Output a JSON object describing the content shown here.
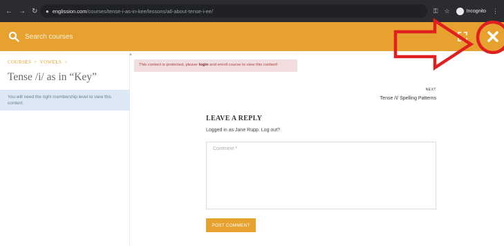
{
  "browser": {
    "url_domain": "englission.com",
    "url_path": "/courses/tense-i-as-in-kee/lessons/all-about-tense-i-ee/",
    "profile_label": "Incognito",
    "icons": [
      "back-arrow",
      "forward-arrow",
      "reload",
      "lock",
      "key",
      "star",
      "incognito-avatar",
      "kebab-menu"
    ]
  },
  "header": {
    "search_placeholder": "Search courses",
    "bg_color": "#e6a12e",
    "icons": [
      "search-icon",
      "expand-icon",
      "close-icon"
    ]
  },
  "sidebar": {
    "breadcrumb": [
      "COURSES",
      "VOWELS"
    ],
    "breadcrumb_sep": ">",
    "lesson_title": "Tense /i/ as in “Key”",
    "membership_note": "You will need the right membership level to view this content."
  },
  "main": {
    "protected_pre": "This content is protected, please ",
    "protected_link": "login",
    "protected_post": " and enroll course to view this content!",
    "next_label": "NEXT",
    "next_title": "Tense /I/ Spelling Patterns",
    "reply_title": "LEAVE A REPLY",
    "logged_in_text": "Logged in as Jane Rupp. Log out?",
    "comment_placeholder": "Comment *",
    "post_button": "POST COMMENT"
  },
  "annotation": {
    "color": "#e02020"
  }
}
